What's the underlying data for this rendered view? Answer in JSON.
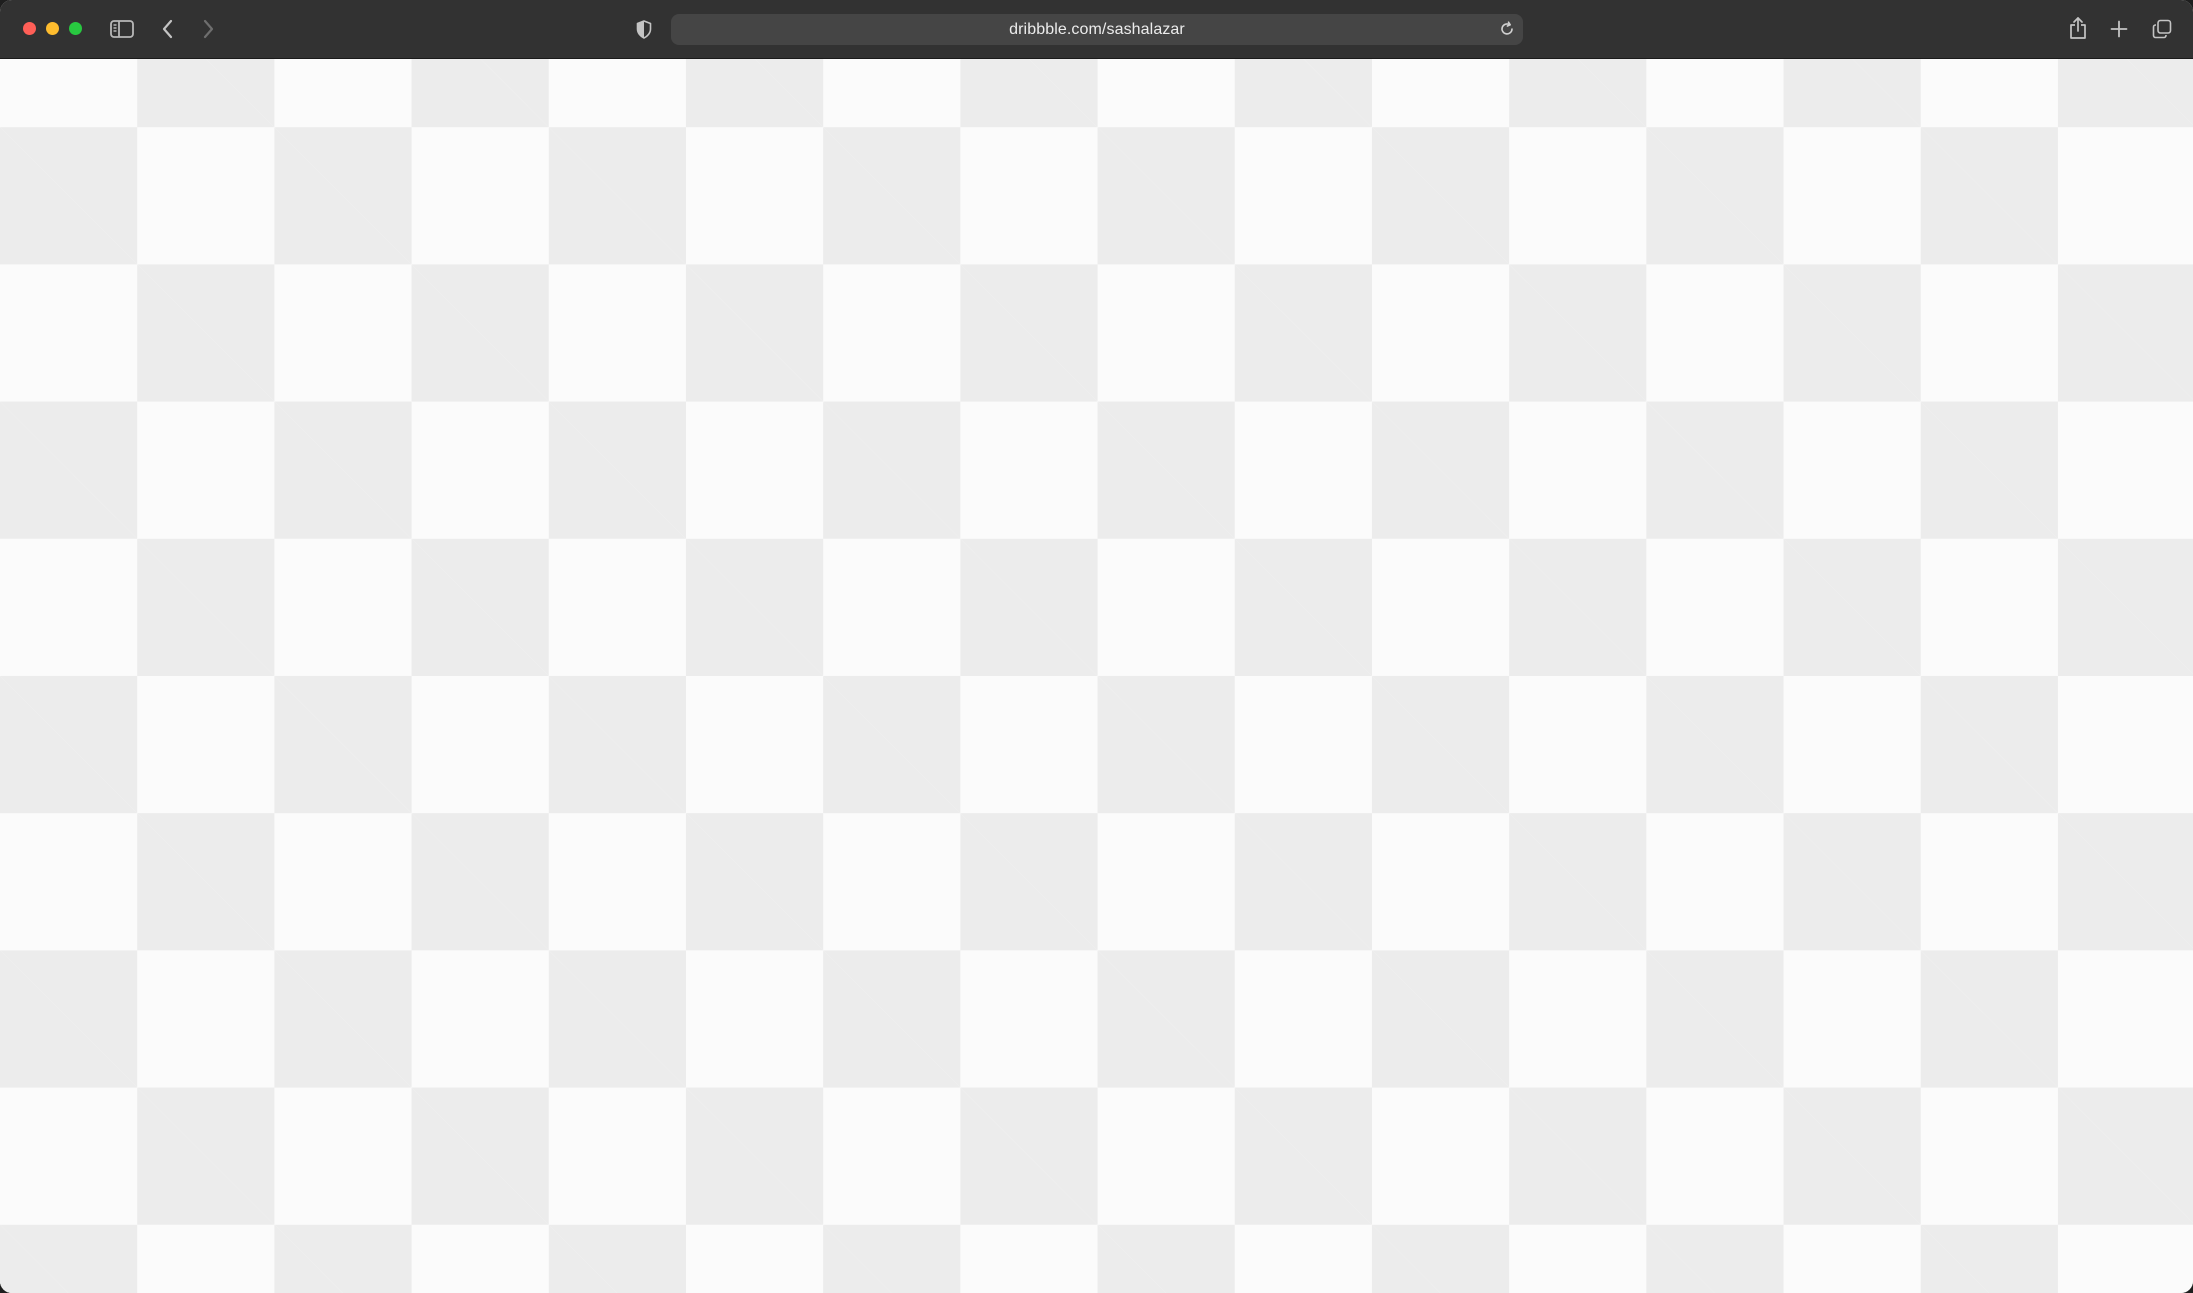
{
  "browser": {
    "url": "dribbble.com/sashalazar",
    "traffic_lights": {
      "close_color": "#ff5f57",
      "minimize_color": "#febc2e",
      "zoom_color": "#28c840"
    },
    "icons": {
      "sidebar": "sidebar-icon",
      "back": "chevron-left-icon",
      "forward": "chevron-right-icon",
      "privacy": "shield-icon",
      "reload": "reload-icon",
      "share": "share-icon",
      "new_tab": "plus-icon",
      "tab_overview": "tabs-overview-icon"
    },
    "toolbar_color": "#323232",
    "address_bar_color": "#454545"
  },
  "page": {
    "content": "transparency-checkerboard",
    "checker_light": "#fbfbfb",
    "checker_dark": "#ececec"
  }
}
